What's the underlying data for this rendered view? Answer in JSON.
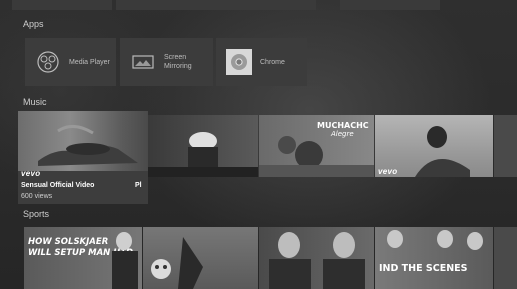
{
  "sections": {
    "apps": "Apps",
    "music": "Music",
    "sports": "Sports"
  },
  "apps": [
    {
      "label": "Media Player",
      "icon": "media-player-icon"
    },
    {
      "label": "Screen\nMirroring",
      "icon": "screen-mirroring-icon"
    },
    {
      "label": "Chrome",
      "icon": "chrome-icon"
    }
  ],
  "music": {
    "focused": {
      "badge": "vevo",
      "title": "Sensual Official Video",
      "views": "600 views"
    },
    "second_title_fragment": "Pl",
    "third_overlay": "MUCHACHC",
    "third_overlay_script": "Alegre",
    "fourth_badge": "vevo"
  },
  "sports": {
    "overlay_1": "HOW SOLSKJAER\nWILL SETUP MAN UTD",
    "overlay_2": "IND THE SCENES"
  }
}
